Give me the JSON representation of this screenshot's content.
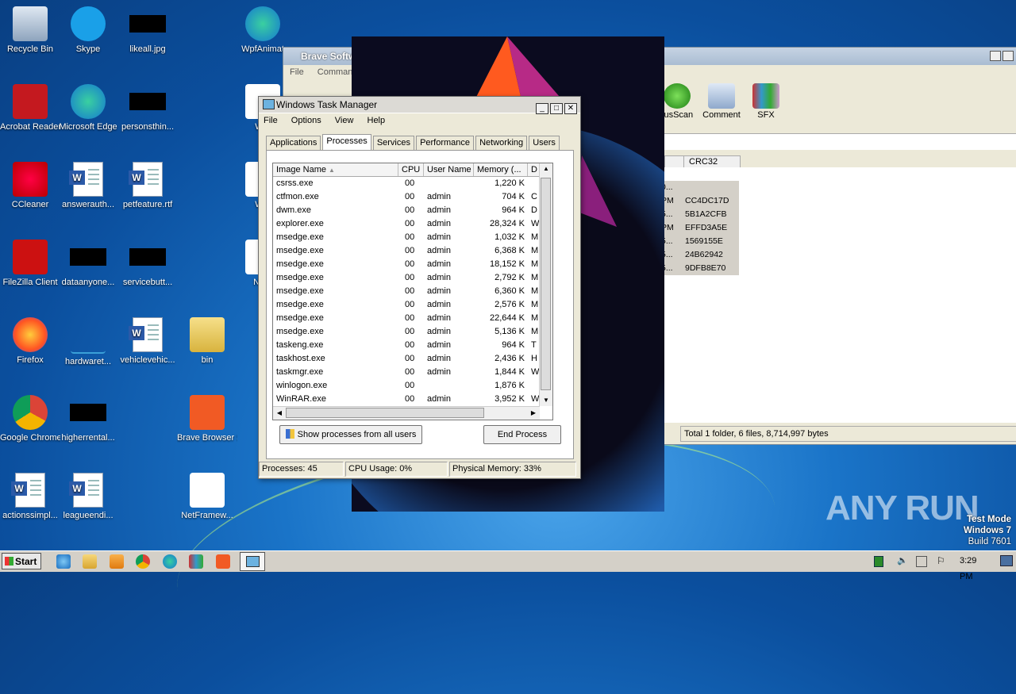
{
  "desktop": {
    "icons": [
      {
        "label": "Recycle Bin"
      },
      {
        "label": "Skype"
      },
      {
        "label": "likeall.jpg"
      },
      {
        "label": "WpfAnimat"
      },
      {
        "label": "Acrobat Reader DC"
      },
      {
        "label": "Microsoft Edge"
      },
      {
        "label": "personsthin..."
      },
      {
        "label": "Wpf"
      },
      {
        "label": "CCleaner"
      },
      {
        "label": "answerauth..."
      },
      {
        "label": "petfeature.rtf"
      },
      {
        "label": "Wpf"
      },
      {
        "label": "FileZilla Client"
      },
      {
        "label": "dataanyone..."
      },
      {
        "label": "servicebutt..."
      },
      {
        "label": "NetF"
      },
      {
        "label": "Firefox"
      },
      {
        "label": "hardwaret..."
      },
      {
        "label": "vehiclevehic..."
      },
      {
        "label": "bin"
      },
      {
        "label": "Google Chrome"
      },
      {
        "label": "higherrental..."
      },
      {
        "label": "Brave Browser Setup.exe"
      },
      {
        "label": "actionssimpl..."
      },
      {
        "label": "leagueendi..."
      },
      {
        "label": "NetFramew..."
      }
    ]
  },
  "winrar": {
    "title": "Brave Softw",
    "menu": [
      "File",
      "Commands"
    ],
    "tools": [
      "rusScan",
      "Comment",
      "SFX"
    ],
    "column": "CRC32",
    "rows": [
      {
        "a": "0...",
        "b": ""
      },
      {
        "a": "PM",
        "b": "CC4DC17D"
      },
      {
        "a": "5...",
        "b": "5B1A2CFB"
      },
      {
        "a": "PM",
        "b": "EFFD3A5E"
      },
      {
        "a": "5...",
        "b": "1569155E"
      },
      {
        "a": "5...",
        "b": "24B62942"
      },
      {
        "a": "5...",
        "b": "9DFB8E70"
      }
    ],
    "status": "Total 1 folder, 6 files, 8,714,997 bytes"
  },
  "taskmgr": {
    "title": "Windows Task Manager",
    "menu": [
      "File",
      "Options",
      "View",
      "Help"
    ],
    "tabs": [
      "Applications",
      "Processes",
      "Services",
      "Performance",
      "Networking",
      "Users"
    ],
    "active_tab": "Processes",
    "columns": [
      "Image Name",
      "CPU",
      "User Name",
      "Memory (...",
      "D"
    ],
    "processes": [
      {
        "name": "csrss.exe",
        "cpu": "00",
        "user": "",
        "mem": "1,220 K",
        "d": ""
      },
      {
        "name": "ctfmon.exe",
        "cpu": "00",
        "user": "admin",
        "mem": "704 K",
        "d": "C"
      },
      {
        "name": "dwm.exe",
        "cpu": "00",
        "user": "admin",
        "mem": "964 K",
        "d": "D"
      },
      {
        "name": "explorer.exe",
        "cpu": "00",
        "user": "admin",
        "mem": "28,324 K",
        "d": "W"
      },
      {
        "name": "msedge.exe",
        "cpu": "00",
        "user": "admin",
        "mem": "1,032 K",
        "d": "M"
      },
      {
        "name": "msedge.exe",
        "cpu": "00",
        "user": "admin",
        "mem": "6,368 K",
        "d": "M"
      },
      {
        "name": "msedge.exe",
        "cpu": "00",
        "user": "admin",
        "mem": "18,152 K",
        "d": "M"
      },
      {
        "name": "msedge.exe",
        "cpu": "00",
        "user": "admin",
        "mem": "2,792 K",
        "d": "M"
      },
      {
        "name": "msedge.exe",
        "cpu": "00",
        "user": "admin",
        "mem": "6,360 K",
        "d": "M"
      },
      {
        "name": "msedge.exe",
        "cpu": "00",
        "user": "admin",
        "mem": "2,576 K",
        "d": "M"
      },
      {
        "name": "msedge.exe",
        "cpu": "00",
        "user": "admin",
        "mem": "22,644 K",
        "d": "M"
      },
      {
        "name": "msedge.exe",
        "cpu": "00",
        "user": "admin",
        "mem": "5,136 K",
        "d": "M"
      },
      {
        "name": "taskeng.exe",
        "cpu": "00",
        "user": "admin",
        "mem": "964 K",
        "d": "T"
      },
      {
        "name": "taskhost.exe",
        "cpu": "00",
        "user": "admin",
        "mem": "2,436 K",
        "d": "H"
      },
      {
        "name": "taskmgr.exe",
        "cpu": "00",
        "user": "admin",
        "mem": "1,844 K",
        "d": "W"
      },
      {
        "name": "winlogon.exe",
        "cpu": "00",
        "user": "",
        "mem": "1,876 K",
        "d": ""
      },
      {
        "name": "WinRAR.exe",
        "cpu": "00",
        "user": "admin",
        "mem": "3,952 K",
        "d": "W"
      }
    ],
    "show_all_label": "Show processes from all users",
    "end_process_label": "End Process",
    "status": {
      "processes": "Processes: 45",
      "cpu": "CPU Usage: 0%",
      "memory": "Physical Memory: 33%"
    }
  },
  "taskbar": {
    "start_label": "Start",
    "clock": "3:29 PM"
  },
  "watermark": "ANY RUN",
  "test_mode": {
    "line1": "Test Mode",
    "line2": "Windows 7",
    "line3": "Build 7601"
  }
}
